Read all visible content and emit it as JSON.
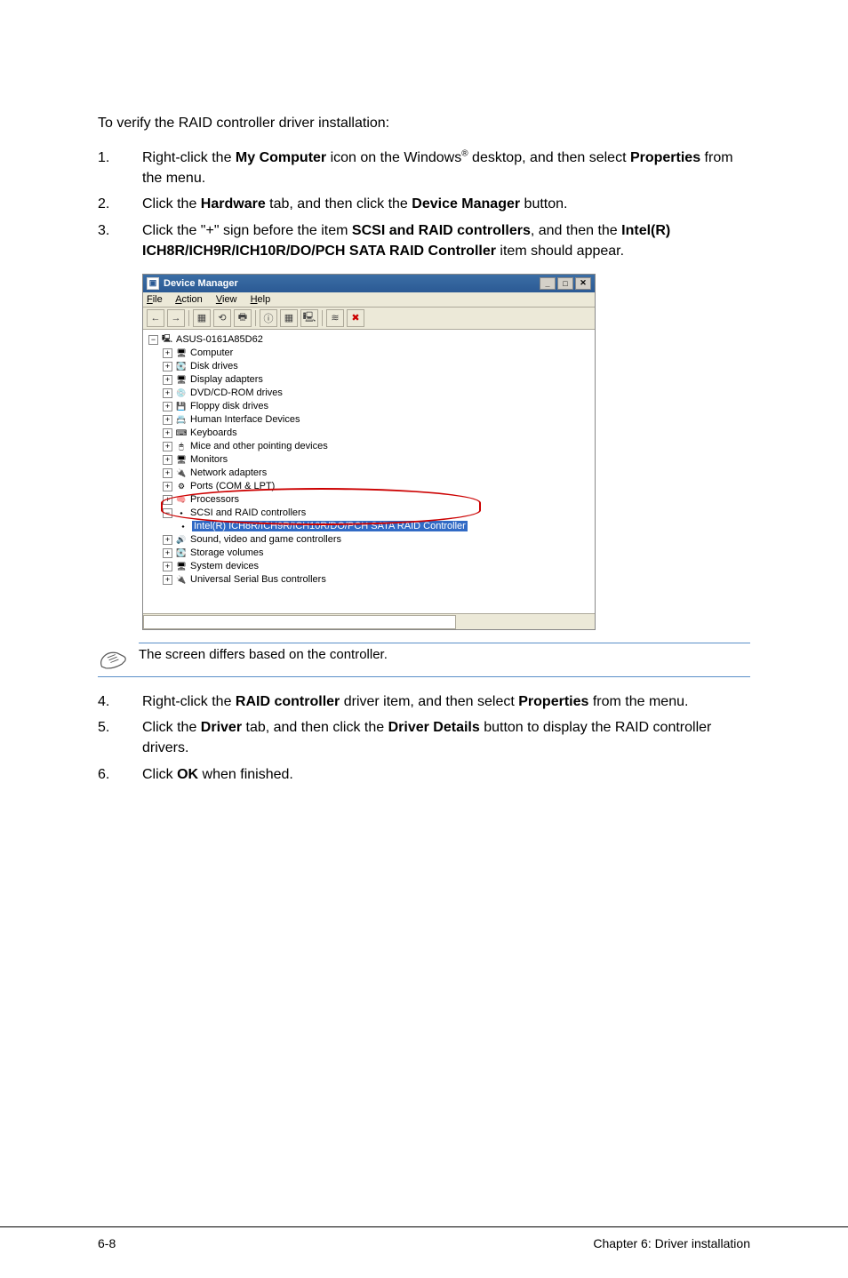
{
  "intro": "To verify the RAID controller driver installation:",
  "steps_top": [
    {
      "num": "1.",
      "pre": "Right-click the ",
      "b1": "My Computer",
      "mid": " icon on the Windows",
      "sup": "®",
      "post1": " desktop, and then select ",
      "b2": "Properties",
      "post2": " from the menu."
    },
    {
      "num": "2.",
      "pre": "Click the ",
      "b1": "Hardware",
      "mid": " tab, and then click the ",
      "b2": "Device Manager",
      "post": " button."
    },
    {
      "num": "3.",
      "pre": "Click the \"+\" sign before the item ",
      "b1": "SCSI and RAID controllers",
      "mid": ", and then the ",
      "b2": "Intel(R) ICH8R/ICH9R/ICH10R/DO/PCH SATA RAID Controller",
      "post": " item should appear."
    }
  ],
  "dm": {
    "title": "Device Manager",
    "menu": [
      "File",
      "Action",
      "View",
      "Help"
    ],
    "toolbar": [
      "←",
      "→",
      "▦",
      "⟲",
      "🖶",
      "ⓘ",
      "▦",
      "🖳",
      "≋",
      "✖"
    ],
    "minimize": "_",
    "maximize": "□",
    "close": "✕",
    "root": "ASUS-0161A85D62",
    "items": [
      {
        "label": "Computer",
        "icon": "🖥"
      },
      {
        "label": "Disk drives",
        "icon": "💽"
      },
      {
        "label": "Display adapters",
        "icon": "🖥"
      },
      {
        "label": "DVD/CD-ROM drives",
        "icon": "💿"
      },
      {
        "label": "Floppy disk drives",
        "icon": "💾"
      },
      {
        "label": "Human Interface Devices",
        "icon": "📇"
      },
      {
        "label": "Keyboards",
        "icon": "⌨"
      },
      {
        "label": "Mice and other pointing devices",
        "icon": "🖱"
      },
      {
        "label": "Monitors",
        "icon": "🖥"
      },
      {
        "label": "Network adapters",
        "icon": "🔌"
      },
      {
        "label": "Ports (COM & LPT)",
        "icon": "⚙"
      },
      {
        "label": "Processors",
        "icon": "🧠"
      }
    ],
    "scsi": {
      "label": "SCSI and RAID controllers",
      "child": "Intel(R) ICH8R/ICH9R/ICH10R/DO/PCH SATA RAID Controller"
    },
    "items_after": [
      {
        "label": "Sound, video and game controllers",
        "icon": "🔊"
      },
      {
        "label": "Storage volumes",
        "icon": "💽"
      },
      {
        "label": "System devices",
        "icon": "🖥"
      },
      {
        "label": "Universal Serial Bus controllers",
        "icon": "🔌"
      }
    ]
  },
  "note": "The screen differs based on the controller.",
  "steps_bottom": [
    {
      "num": "4.",
      "pre": "Right-click the ",
      "b1": "RAID controller",
      "mid": " driver item, and then select ",
      "b2": "Properties",
      "post": " from the menu."
    },
    {
      "num": "5.",
      "pre": "Click the ",
      "b1": "Driver",
      "mid": " tab, and then click the ",
      "b2": "Driver Details",
      "post": " button to display the RAID controller drivers."
    },
    {
      "num": "6.",
      "pre": "Click ",
      "b1": "OK",
      "post": " when finished."
    }
  ],
  "footer": {
    "left": "6-8",
    "right": "Chapter 6: Driver installation"
  }
}
